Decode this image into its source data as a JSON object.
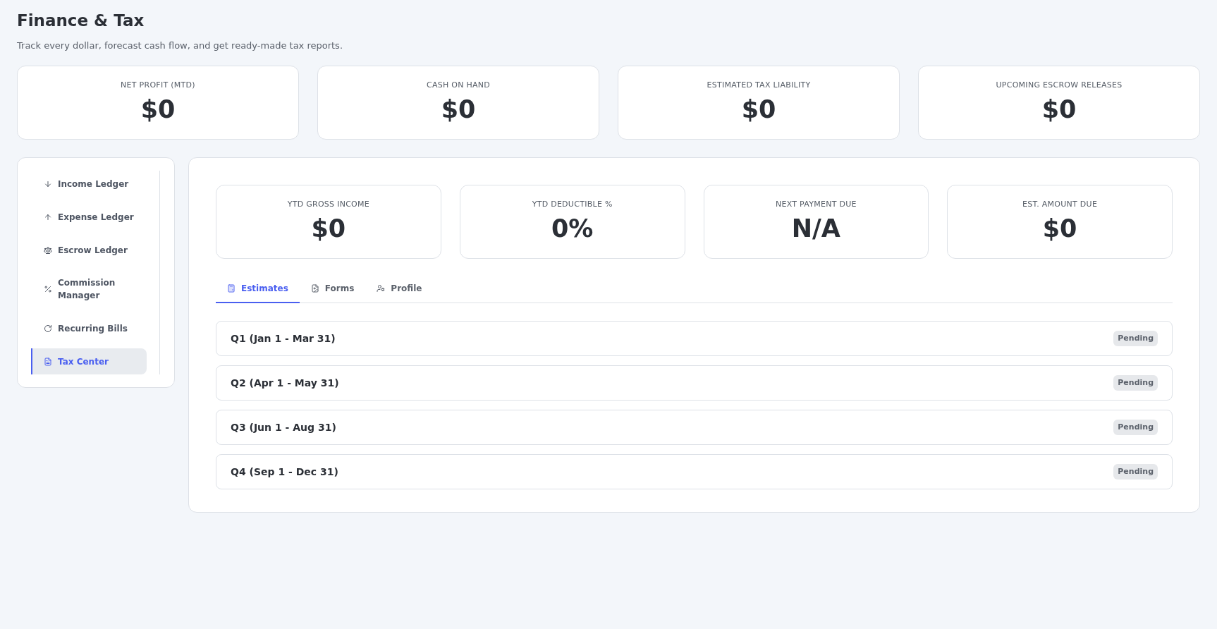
{
  "header": {
    "title": "Finance & Tax",
    "subtitle": "Track every dollar, forecast cash flow, and get ready-made tax reports."
  },
  "summary_cards": [
    {
      "label": "NET PROFIT (MTD)",
      "value": "$0"
    },
    {
      "label": "CASH ON HAND",
      "value": "$0"
    },
    {
      "label": "ESTIMATED TAX LIABILITY",
      "value": "$0"
    },
    {
      "label": "UPCOMING ESCROW RELEASES",
      "value": "$0"
    }
  ],
  "sidebar": {
    "items": [
      {
        "label": "Income Ledger",
        "selected": false
      },
      {
        "label": "Expense Ledger",
        "selected": false
      },
      {
        "label": "Escrow Ledger",
        "selected": false
      },
      {
        "label": "Commission Manager",
        "selected": false
      },
      {
        "label": "Recurring Bills",
        "selected": false
      },
      {
        "label": "Tax Center",
        "selected": true
      }
    ]
  },
  "tax_center": {
    "stats": [
      {
        "label": "YTD GROSS INCOME",
        "value": "$0"
      },
      {
        "label": "YTD DEDUCTIBLE %",
        "value": "0%"
      },
      {
        "label": "NEXT PAYMENT DUE",
        "value": "N/A"
      },
      {
        "label": "EST. AMOUNT DUE",
        "value": "$0"
      }
    ],
    "tabs": [
      {
        "label": "Estimates",
        "selected": true
      },
      {
        "label": "Forms",
        "selected": false
      },
      {
        "label": "Profile",
        "selected": false
      }
    ],
    "quarters": [
      {
        "name": "Q1 (Jan 1 - Mar 31)",
        "status": "Pending"
      },
      {
        "name": "Q2 (Apr 1 - May 31)",
        "status": "Pending"
      },
      {
        "name": "Q3 (Jun 1 - Aug 31)",
        "status": "Pending"
      },
      {
        "name": "Q4 (Sep 1 - Dec 31)",
        "status": "Pending"
      }
    ]
  }
}
